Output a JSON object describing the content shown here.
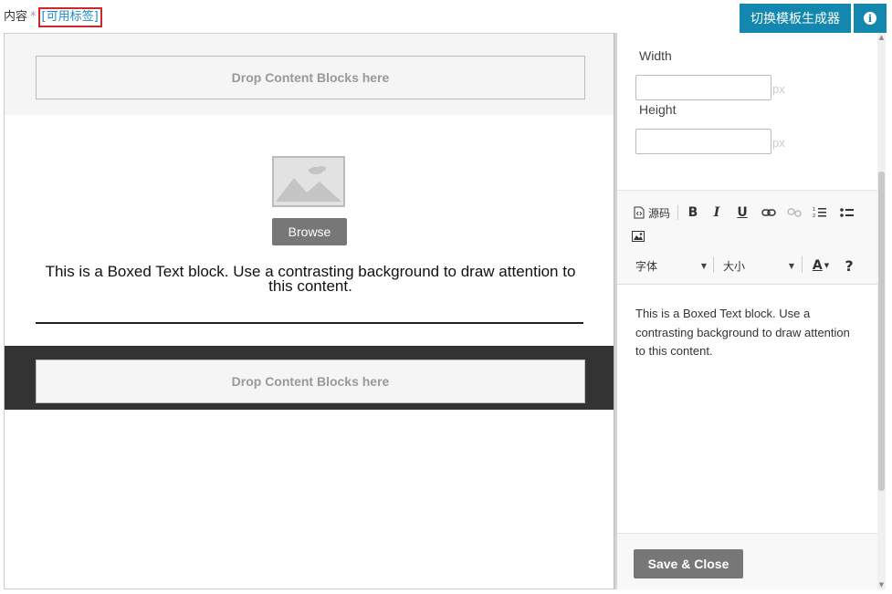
{
  "header": {
    "field_label": "内容",
    "required_mark": "*",
    "tags_link": "[可用标签]",
    "switch_builder_label": "切换模板生成器",
    "info_icon": "i"
  },
  "canvas": {
    "drop_zone_top": "Drop Content Blocks here",
    "browse_label": "Browse",
    "boxed_text": "This is a Boxed Text block. Use a contrasting background to draw attention to this content.",
    "drop_zone_bottom": "Drop Content Blocks here",
    "dark_band_color": "#333333"
  },
  "panel": {
    "width_label": "Width",
    "width_value": "",
    "width_unit": "px",
    "height_label": "Height",
    "height_value": "",
    "height_unit": "px",
    "toolbar": {
      "source_label": "源码",
      "bold": "B",
      "italic": "I",
      "underline": "U",
      "font_combo": "字体",
      "size_combo": "大小",
      "text_color": "A",
      "help": "?"
    },
    "editor_text": "This is a Boxed Text block. Use a contrasting background to draw attention to this content.",
    "save_close_label": "Save & Close"
  },
  "colors": {
    "accent": "#1387ad",
    "tags_border": "#d1262b",
    "link": "#1a8ac6",
    "grey_button": "#777777"
  }
}
